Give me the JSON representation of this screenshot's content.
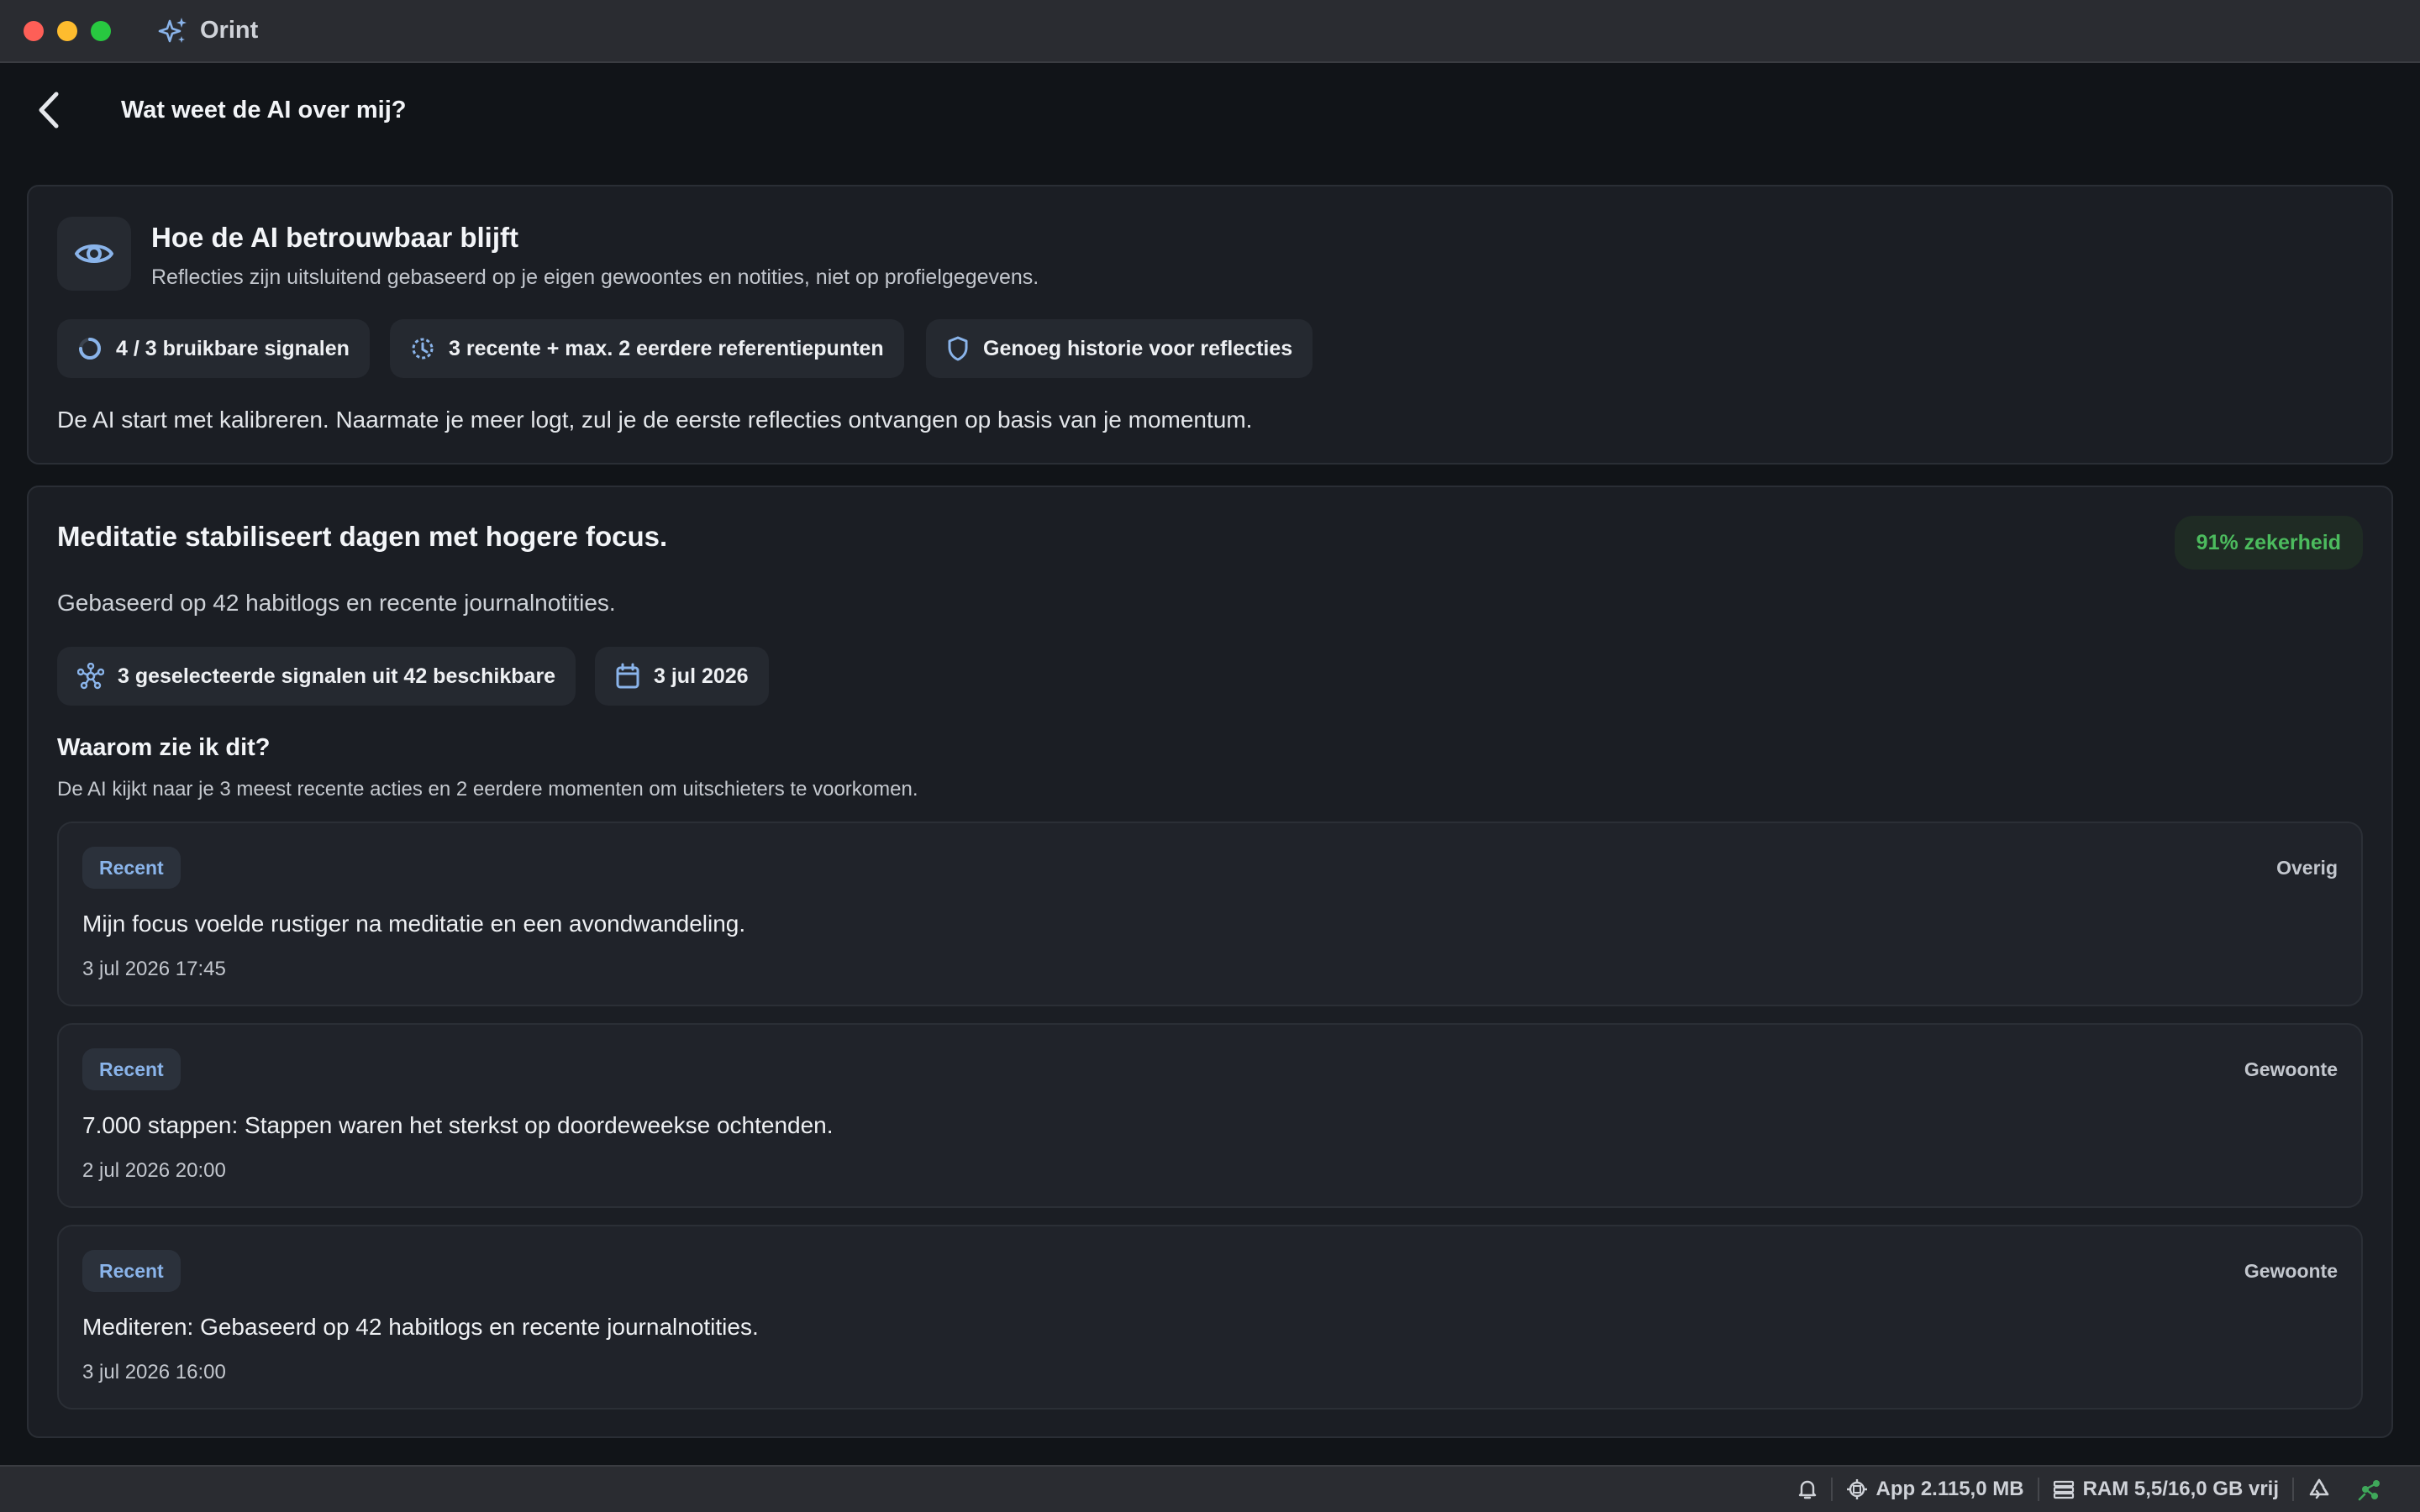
{
  "window": {
    "app_name": "Orint"
  },
  "header": {
    "title": "Wat weet de AI over mij?"
  },
  "trust_card": {
    "title": "Hoe de AI betrouwbaar blijft",
    "subtitle": "Reflecties zijn uitsluitend gebaseerd op je eigen gewoontes en notities, niet op profielgegevens.",
    "chips": [
      {
        "icon": "progress-ring-icon",
        "label": "4 / 3 bruikbare signalen"
      },
      {
        "icon": "history-clock-icon",
        "label": "3 recente + max. 2 eerdere referentiepunten"
      },
      {
        "icon": "shield-icon",
        "label": "Genoeg historie voor reflecties"
      }
    ],
    "description": "De AI start met kalibreren. Naarmate je meer logt, zul je de eerste reflecties ontvangen op basis van je momentum."
  },
  "insight_card": {
    "title": "Meditatie stabiliseert dagen met hogere focus.",
    "confidence": "91% zekerheid",
    "subtitle": "Gebaseerd op 42 habitlogs en recente journalnotities.",
    "chips": [
      {
        "icon": "network-nodes-icon",
        "label": "3 geselecteerde signalen uit 42 beschikbare"
      },
      {
        "icon": "calendar-icon",
        "label": "3 jul 2026"
      }
    ],
    "why_title": "Waarom zie ik dit?",
    "why_description": "De AI kijkt naar je 3 meest recente acties en 2 eerdere momenten om uitschieters te voorkomen.",
    "items": [
      {
        "tag": "Recent",
        "category": "Overig",
        "text": "Mijn focus voelde rustiger na meditatie en een avondwandeling.",
        "time": "3 jul 2026 17:45"
      },
      {
        "tag": "Recent",
        "category": "Gewoonte",
        "text": "7.000 stappen: Stappen waren het sterkst op doordeweekse ochtenden.",
        "time": "2 jul 2026 20:00"
      },
      {
        "tag": "Recent",
        "category": "Gewoonte",
        "text": "Mediteren: Gebaseerd op 42 habitlogs en recente journalnotities.",
        "time": "3 jul 2026 16:00"
      }
    ]
  },
  "statusbar": {
    "app_memory": "App 2.115,0 MB",
    "ram": "RAM 5,5/16,0 GB vrij"
  },
  "colors": {
    "accent_blue": "#8ab4ea",
    "confidence_green": "#4cbb5e",
    "background": "#111418",
    "card": "#1b1e24"
  }
}
